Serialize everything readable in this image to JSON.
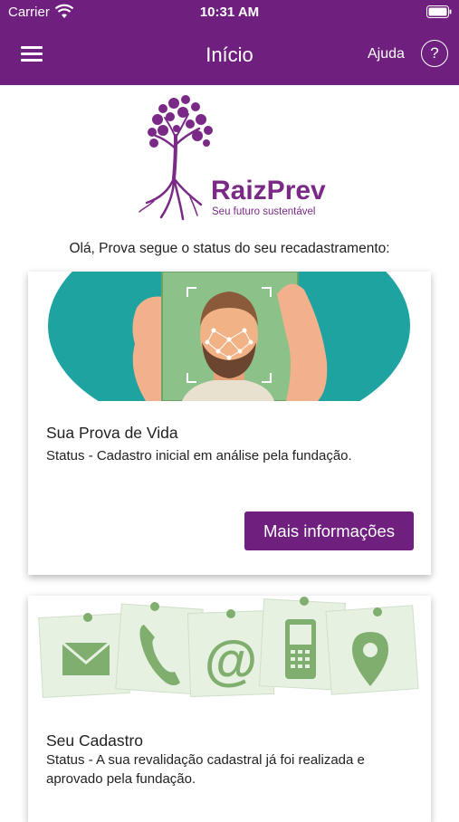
{
  "status_bar": {
    "carrier": "Carrier",
    "time": "10:31 AM"
  },
  "nav": {
    "title": "Início",
    "help_label": "Ajuda",
    "help_icon": "?"
  },
  "logo": {
    "brand": "RaizPrev",
    "tagline": "Seu futuro sustentável"
  },
  "greeting": "Olá, Prova segue o status do seu recadastramento:",
  "cards": [
    {
      "title": "Sua Prova de Vida",
      "status": "Status - Cadastro inicial em análise pela fundação.",
      "button_label": "Mais informações"
    },
    {
      "title": "Seu Cadastro",
      "status": "Status - A sua revalidação cadastral já foi realizada e aprovado pela fundação."
    }
  ],
  "colors": {
    "primary": "#6f1f7e",
    "teal": "#1ea3a0",
    "green": "#7fae6e"
  }
}
